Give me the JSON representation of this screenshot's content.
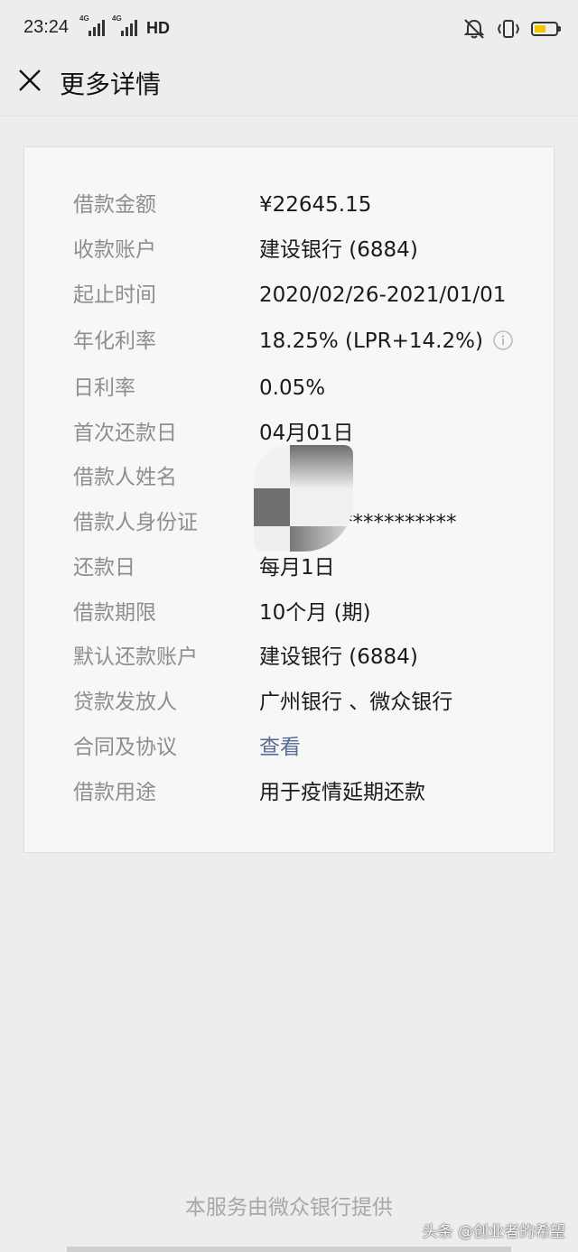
{
  "status_bar": {
    "time": "23:24",
    "net1": "4G",
    "net2": "4G",
    "hd": "HD",
    "battery_level": 0.55,
    "battery_color": "#f2c500"
  },
  "header": {
    "title": "更多详情",
    "close_icon": "close-icon"
  },
  "details": [
    {
      "label": "借款金额",
      "value": "¥22645.15"
    },
    {
      "label": "收款账户",
      "value": "建设银行 (6884)"
    },
    {
      "label": "起止时间",
      "value": "2020/02/26-2021/01/01"
    },
    {
      "label": "年化利率",
      "value": "18.25% (LPR+14.2%)"
    },
    {
      "label": "日利率",
      "value": "0.05%"
    },
    {
      "label": "首次还款日",
      "value": "04月01日"
    },
    {
      "label": "借款人姓名",
      "value": ""
    },
    {
      "label": "借款人身份证",
      "value": "***********"
    },
    {
      "label": "还款日",
      "value": "每月1日"
    },
    {
      "label": "借款期限",
      "value": "10个月 (期)"
    },
    {
      "label": "默认还款账户",
      "value": "建设银行 (6884)"
    },
    {
      "label": "贷款发放人",
      "value": "广州银行 、微众银行"
    },
    {
      "label": "合同及协议",
      "value": "查看"
    },
    {
      "label": "借款用途",
      "value": "用于疫情延期还款"
    }
  ],
  "footer": {
    "provider_text": "本服务由微众银行提供",
    "watermark": "头条 @创业者的希望"
  },
  "colors": {
    "background": "#ededed",
    "card": "#f7f7f7",
    "link": "#576b95",
    "label": "#8e8e8e"
  }
}
